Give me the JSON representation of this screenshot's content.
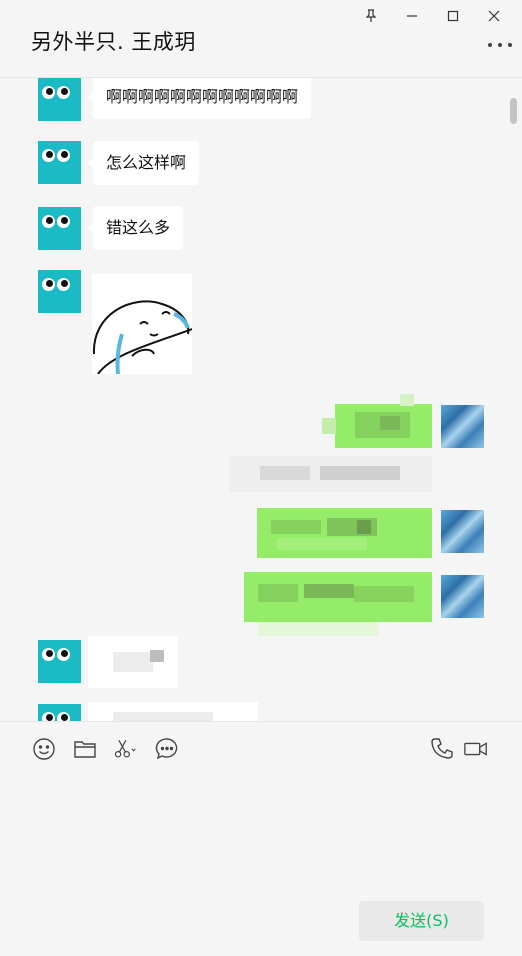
{
  "window": {
    "title": "另外半只. 王成玥"
  },
  "messages": [
    {
      "from": "other",
      "type": "text",
      "text": "啊啊啊啊啊啊啊啊啊啊啊啊"
    },
    {
      "from": "other",
      "type": "text",
      "text": "怎么这样啊"
    },
    {
      "from": "other",
      "type": "text",
      "text": "错这么多"
    },
    {
      "from": "other",
      "type": "sticker",
      "icon": "crying-bun-sticker"
    },
    {
      "from": "self",
      "type": "text-obscured"
    },
    {
      "from": "self",
      "type": "text-obscured"
    },
    {
      "from": "self",
      "type": "text-obscured"
    },
    {
      "from": "self",
      "type": "text-obscured"
    },
    {
      "from": "other",
      "type": "text-obscured"
    },
    {
      "from": "other",
      "type": "text-obscured"
    }
  ],
  "toolbar": {
    "icons": [
      "emoji-icon",
      "folder-icon",
      "scissors-icon",
      "chat-history-icon",
      "phone-icon",
      "video-icon"
    ]
  },
  "composer": {
    "send_label": "发送(S)"
  },
  "colors": {
    "accent": "#07c160",
    "self_bubble": "#95ec69",
    "avatar": "#1bbbc6",
    "background": "#f5f5f5"
  }
}
